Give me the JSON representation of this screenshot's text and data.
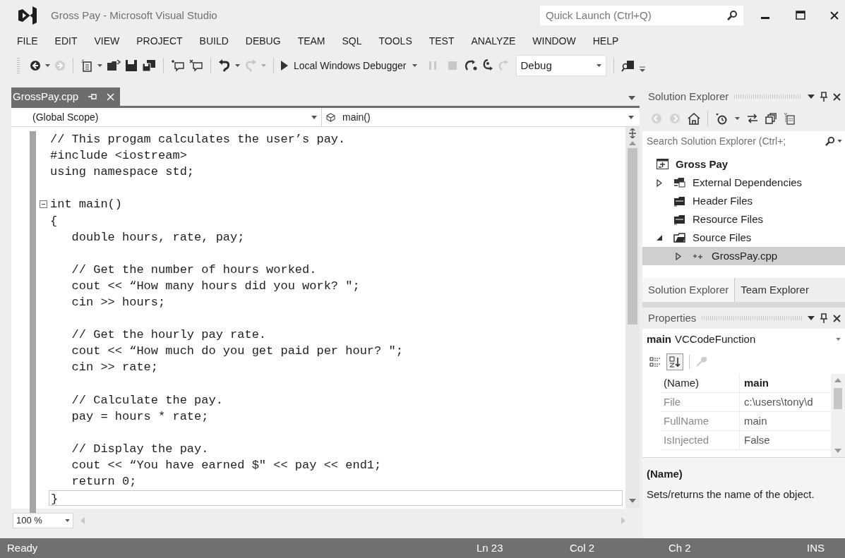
{
  "window": {
    "title": "Gross Pay - Microsoft Visual Studio",
    "quick_launch": {
      "placeholder": "Quick Launch (Ctrl+Q)"
    }
  },
  "menu": [
    "FILE",
    "EDIT",
    "VIEW",
    "PROJECT",
    "BUILD",
    "DEBUG",
    "TEAM",
    "SQL",
    "TOOLS",
    "TEST",
    "ANALYZE",
    "WINDOW",
    "HELP"
  ],
  "toolbar": {
    "debugger": "Local Windows Debugger",
    "configuration": "Debug"
  },
  "document_tabs": [
    {
      "label": "GrossPay.cpp",
      "selected": true
    }
  ],
  "navigation": {
    "scope": "(Global Scope)",
    "member": "main()"
  },
  "code_lines": [
    {
      "kind": "code",
      "text": "// This progam calculates the user’s pay."
    },
    {
      "kind": "code",
      "text": "#include <iostream>"
    },
    {
      "kind": "code",
      "text": "using namespace std;"
    },
    {
      "kind": "blank"
    },
    {
      "kind": "fold",
      "text": "int main()"
    },
    {
      "kind": "code",
      "text": "{"
    },
    {
      "kind": "code",
      "text": "   double hours, rate, pay;"
    },
    {
      "kind": "blank"
    },
    {
      "kind": "code",
      "text": "   // Get the number of hours worked."
    },
    {
      "kind": "code",
      "text": "   cout << “How many hours did you work? \";"
    },
    {
      "kind": "code",
      "text": "   cin >> hours;"
    },
    {
      "kind": "blank"
    },
    {
      "kind": "code",
      "text": "   // Get the hourly pay rate."
    },
    {
      "kind": "code",
      "text": "   cout << “How much do you get paid per hour? \";"
    },
    {
      "kind": "code",
      "text": "   cin >> rate;"
    },
    {
      "kind": "blank"
    },
    {
      "kind": "code",
      "text": "   // Calculate the pay."
    },
    {
      "kind": "code",
      "text": "   pay = hours * rate;"
    },
    {
      "kind": "blank"
    },
    {
      "kind": "code",
      "text": "   // Display the pay."
    },
    {
      "kind": "code",
      "text": "   cout << “You have earned $\" << pay << end1;"
    },
    {
      "kind": "code",
      "text": "   return 0;"
    },
    {
      "kind": "current",
      "text": "}"
    }
  ],
  "zoom": "100 %",
  "solution_explorer": {
    "title": "Solution Explorer",
    "search": {
      "placeholder": "Search Solution Explorer (Ctrl+;"
    },
    "tree": [
      {
        "label": "Gross Pay",
        "kind": "project",
        "selected": false,
        "children": [
          {
            "label": "External Dependencies",
            "kind": "dependencies",
            "expanded": false,
            "selected": false
          },
          {
            "label": "Header Files",
            "kind": "folder",
            "selected": false
          },
          {
            "label": "Resource Files",
            "kind": "folder",
            "selected": false
          },
          {
            "label": "Source Files",
            "kind": "folder-open",
            "expanded": true,
            "selected": false,
            "children": [
              {
                "label": "GrossPay.cpp",
                "kind": "cpp",
                "expanded": false,
                "selected": true
              }
            ]
          }
        ]
      }
    ],
    "tabs": [
      {
        "label": "Solution Explorer",
        "selected": true
      },
      {
        "label": "Team Explorer",
        "selected": false
      }
    ]
  },
  "properties": {
    "title": "Properties",
    "object": {
      "name": "main",
      "type": "VCCodeFunction"
    },
    "view_buttons": [
      {
        "kind": "categorized",
        "selected": false
      },
      {
        "kind": "alphabetical",
        "selected": true
      }
    ],
    "rows": [
      {
        "name": "(Name)",
        "value": "main",
        "readonly": false
      },
      {
        "name": "File",
        "value": "c:\\users\\tony\\d",
        "readonly": true
      },
      {
        "name": "FullName",
        "value": "main",
        "readonly": true
      },
      {
        "name": "IsInjected",
        "value": "False",
        "readonly": true
      }
    ],
    "description": {
      "title": "(Name)",
      "text": "Sets/returns the name of the object."
    }
  },
  "status_bar": {
    "message": "Ready",
    "line": "Ln 23",
    "column": "Col 2",
    "char": "Ch 2",
    "mode": "INS"
  }
}
